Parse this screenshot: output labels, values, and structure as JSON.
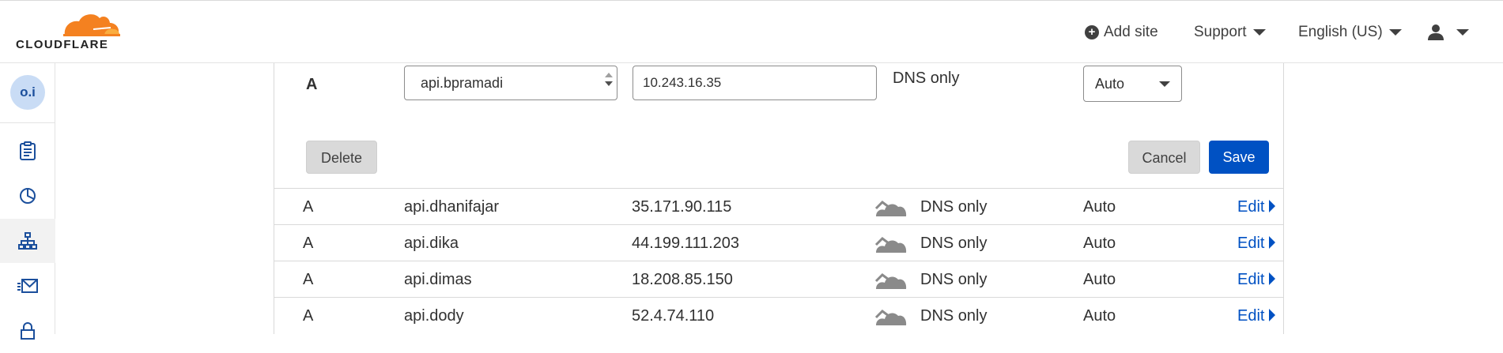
{
  "brand": {
    "logo_text": "CLOUDFLARE",
    "orange": "#f48120",
    "orange_light": "#faad3f"
  },
  "header": {
    "add_site": "Add site",
    "support": "Support",
    "language": "English (US)"
  },
  "sidebar": {
    "account_initials": "o.i",
    "items": [
      {
        "icon": "clipboard-icon",
        "active": false
      },
      {
        "icon": "analytics-pie-icon",
        "active": false
      },
      {
        "icon": "dns-network-icon",
        "active": true
      },
      {
        "icon": "email-icon",
        "active": false
      },
      {
        "icon": "lock-icon",
        "active": false
      }
    ]
  },
  "edit_record": {
    "type": "A",
    "name_value": "api.bpramadi",
    "content_value": "10.243.16.35",
    "proxy_status": "DNS only",
    "ttl_value": "Auto",
    "delete_label": "Delete",
    "cancel_label": "Cancel",
    "save_label": "Save"
  },
  "records": [
    {
      "type": "A",
      "name": "api.dhanifajar",
      "content": "35.171.90.115",
      "proxy": "DNS only",
      "ttl": "Auto",
      "edit": "Edit"
    },
    {
      "type": "A",
      "name": "api.dika",
      "content": "44.199.111.203",
      "proxy": "DNS only",
      "ttl": "Auto",
      "edit": "Edit"
    },
    {
      "type": "A",
      "name": "api.dimas",
      "content": "18.208.85.150",
      "proxy": "DNS only",
      "ttl": "Auto",
      "edit": "Edit"
    },
    {
      "type": "A",
      "name": "api.dody",
      "content": "52.4.74.110",
      "proxy": "DNS only",
      "ttl": "Auto",
      "edit": "Edit"
    }
  ],
  "colors": {
    "primary_blue": "#0051c3",
    "icon_blue": "#1b4f9c",
    "cloud_gray": "#8a8a8a"
  }
}
